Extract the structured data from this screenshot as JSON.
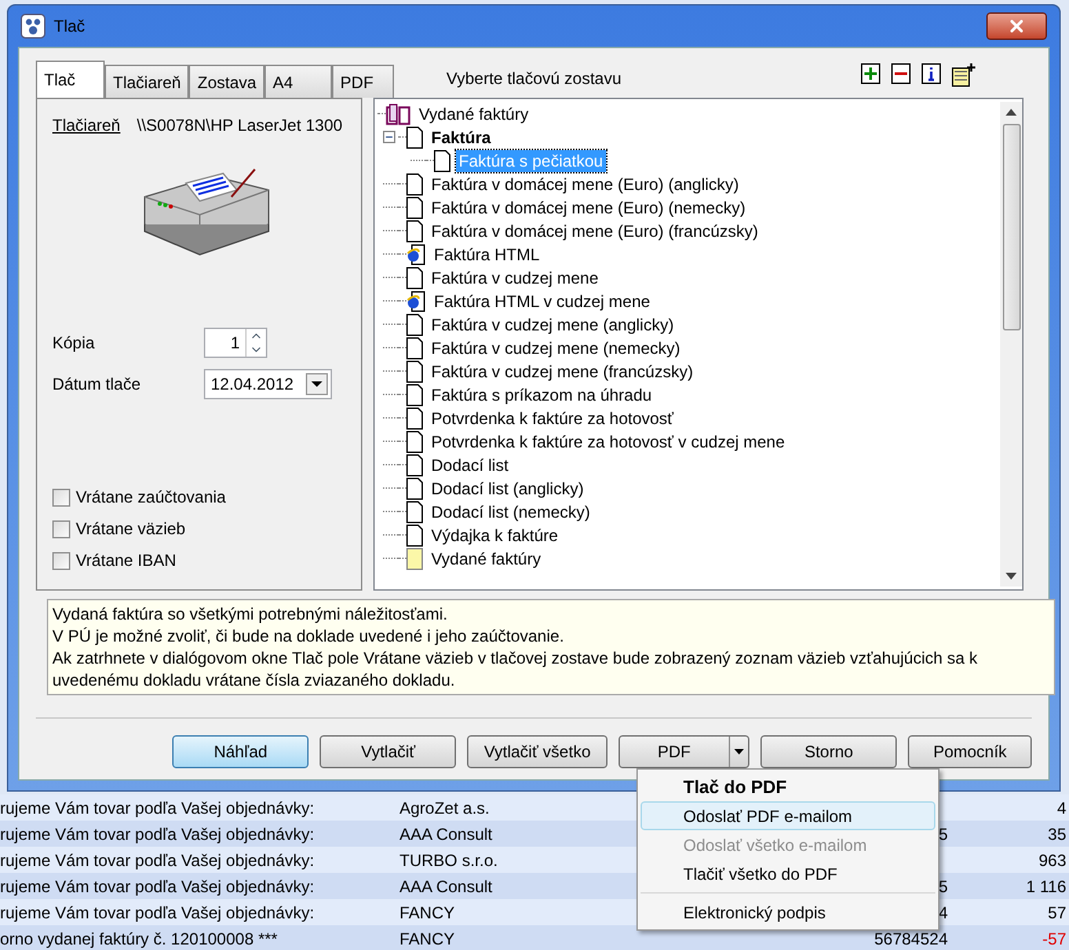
{
  "dialog": {
    "title": "Tlač",
    "tabs": [
      {
        "label": "Tlač",
        "selected": true
      },
      {
        "label": "Tlačiareň",
        "selected": false
      },
      {
        "label": "Zostava",
        "selected": false
      },
      {
        "label": "A4",
        "selected": false
      },
      {
        "label": "PDF",
        "selected": false
      }
    ],
    "report_caption": "Vyberte tlačovú zostavu",
    "printer": {
      "link": "Tlačiareň",
      "path": "\\\\S0078N\\HP LaserJet 1300"
    },
    "copies": {
      "label": "Kópia",
      "value": "1"
    },
    "print_date": {
      "label": "Dátum tlače",
      "value": "12.04.2012"
    },
    "options": [
      {
        "label": "Vrátane zaúčtovania",
        "checked": false
      },
      {
        "label": "Vrátane väzieb",
        "checked": false
      },
      {
        "label": "Vrátane IBAN",
        "checked": false
      }
    ],
    "tree": {
      "label": "Vydané faktúry",
      "kind": "book",
      "selected": false,
      "children": [
        {
          "label": "Faktúra",
          "kind": "doc",
          "is_default": true,
          "selected": false,
          "expanded": true,
          "children": [
            {
              "label": "Faktúra s pečiatkou",
              "kind": "doc",
              "selected": true
            }
          ]
        },
        {
          "label": "Faktúra v domácej mene (Euro) (anglicky)",
          "kind": "doc",
          "selected": false
        },
        {
          "label": "Faktúra v domácej mene (Euro) (nemecky)",
          "kind": "doc",
          "selected": false
        },
        {
          "label": "Faktúra v domácej mene (Euro) (francúzsky)",
          "kind": "doc",
          "selected": false
        },
        {
          "label": "Faktúra HTML",
          "kind": "html",
          "selected": false
        },
        {
          "label": "Faktúra v cudzej mene",
          "kind": "doc",
          "selected": false
        },
        {
          "label": "Faktúra HTML v cudzej mene",
          "kind": "html",
          "selected": false
        },
        {
          "label": "Faktúra v cudzej mene (anglicky)",
          "kind": "doc",
          "selected": false
        },
        {
          "label": "Faktúra v cudzej mene (nemecky)",
          "kind": "doc",
          "selected": false
        },
        {
          "label": "Faktúra v cudzej mene (francúzsky)",
          "kind": "doc",
          "selected": false
        },
        {
          "label": "Faktúra s príkazom na úhradu",
          "kind": "doc",
          "selected": false
        },
        {
          "label": "Potvrdenka k faktúre za hotovosť",
          "kind": "doc",
          "selected": false
        },
        {
          "label": "Potvrdenka k faktúre za hotovosť v cudzej mene",
          "kind": "doc",
          "selected": false
        },
        {
          "label": "Dodací list",
          "kind": "doc",
          "selected": false
        },
        {
          "label": "Dodací list (anglicky)",
          "kind": "doc",
          "selected": false
        },
        {
          "label": "Dodací list (nemecky)",
          "kind": "doc",
          "selected": false
        },
        {
          "label": "Výdajka k faktúre",
          "kind": "doc",
          "selected": false
        },
        {
          "label": "Vydané faktúry",
          "kind": "sheet",
          "selected": false
        }
      ]
    },
    "description": [
      "Vydaná faktúra so všetkými potrebnými náležitosťami.",
      "V PÚ je možné zvoliť, či bude na doklade uvedené i jeho zaúčtovanie.",
      "Ak zatrhnete v dialógovom okne Tlač pole Vrátane väzieb v tlačovej zostave bude zobrazený zoznam väzieb vzťahujúcich sa k uvedenému dokladu vrátane čísla zviazaného dokladu."
    ],
    "buttons": [
      {
        "label": "Náhľad",
        "kind": "default"
      },
      {
        "label": "Vytlačiť",
        "kind": "plain"
      },
      {
        "label": "Vytlačiť všetko",
        "kind": "plain"
      },
      {
        "label": "PDF",
        "kind": "split"
      },
      {
        "label": "Storno",
        "kind": "plain"
      },
      {
        "label": "Pomocník",
        "kind": "plain"
      }
    ]
  },
  "pdf_menu": {
    "groups": [
      [
        {
          "label": "Tlač do PDF",
          "kind": "header",
          "disabled": false,
          "selected": false
        },
        {
          "label": "Odoslať PDF e-mailom",
          "kind": "item",
          "disabled": false,
          "selected": true
        },
        {
          "label": "Odoslať všetko e-mailom",
          "kind": "item",
          "disabled": true,
          "selected": false
        },
        {
          "label": "Tlačiť všetko do PDF",
          "kind": "item",
          "disabled": false,
          "selected": false
        }
      ],
      [
        {
          "label": "Elektronický podpis",
          "kind": "item",
          "disabled": false,
          "selected": false
        }
      ]
    ]
  },
  "background_rows": [
    {
      "text": "rujeme Vám tovar podľa Vašej objednávky:",
      "company": "AgroZet a.s.",
      "column_3": "",
      "amount": "4",
      "negative": false
    },
    {
      "text": "rujeme Vám tovar podľa Vašej objednávky:",
      "company": "AAA Consult",
      "column_3": "5",
      "amount": "35",
      "negative": false
    },
    {
      "text": "rujeme Vám tovar podľa Vašej objednávky:",
      "company": "TURBO s.r.o.",
      "column_3": "",
      "amount": "963",
      "negative": false
    },
    {
      "text": "rujeme Vám tovar podľa Vašej objednávky:",
      "company": "AAA Consult",
      "column_3": "5",
      "amount": "1 116",
      "negative": false
    },
    {
      "text": "rujeme Vám tovar podľa Vašej objednávky:",
      "company": "FANCY",
      "column_3": "4",
      "amount": "57",
      "negative": false
    },
    {
      "text": "orno vydanej faktúry č. 120100008 ***",
      "company": "FANCY",
      "column_3": "56784524",
      "amount": "-57",
      "negative": true
    }
  ]
}
